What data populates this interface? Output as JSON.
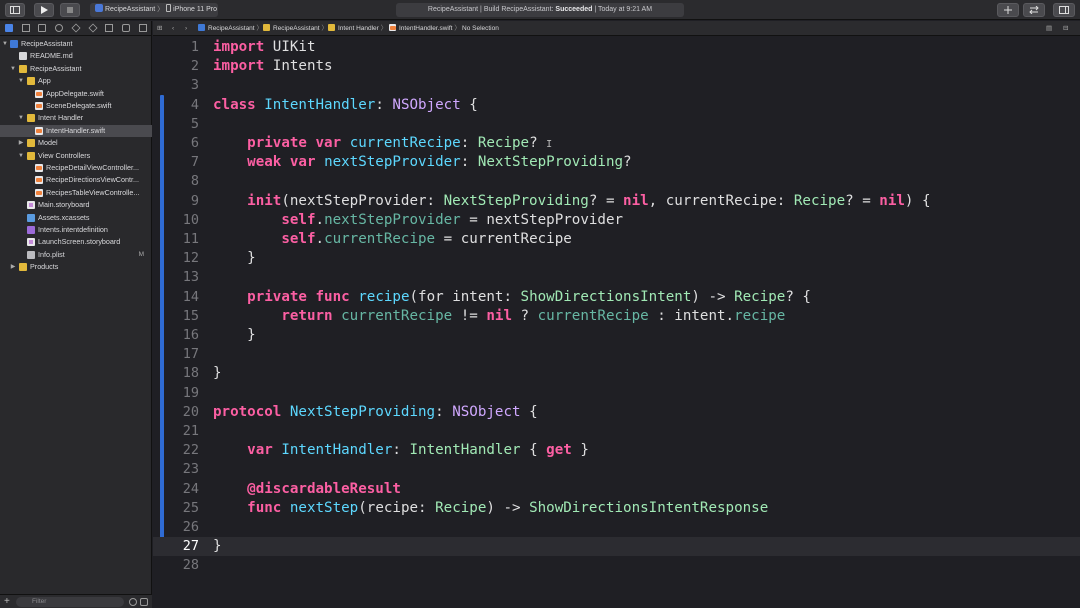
{
  "toolbar": {
    "scheme": "RecipeAssistant",
    "device": "iPhone 11 Pro",
    "activity_prefix": "RecipeAssistant | Build RecipeAssistant: ",
    "activity_status": "Succeeded",
    "activity_time": " | Today at 9:21 AM"
  },
  "navigator": {
    "items": [
      {
        "label": "RecipeAssistant",
        "icon": "project-icon"
      },
      {
        "label": "README.md",
        "icon": "document-icon"
      },
      {
        "label": "RecipeAssistant",
        "icon": "folder-icon"
      },
      {
        "label": "App",
        "icon": "folder-icon"
      },
      {
        "label": "AppDelegate.swift",
        "icon": "swift-file-icon"
      },
      {
        "label": "SceneDelegate.swift",
        "icon": "swift-file-icon"
      },
      {
        "label": "Intent Handler",
        "icon": "folder-icon"
      },
      {
        "label": "IntentHandler.swift",
        "icon": "swift-file-icon"
      },
      {
        "label": "Model",
        "icon": "folder-icon"
      },
      {
        "label": "View Controllers",
        "icon": "folder-icon"
      },
      {
        "label": "RecipeDetailViewController...",
        "icon": "swift-file-icon"
      },
      {
        "label": "RecipeDirectionsViewContr...",
        "icon": "swift-file-icon"
      },
      {
        "label": "RecipesTableViewControlle...",
        "icon": "swift-file-icon"
      },
      {
        "label": "Main.storyboard",
        "icon": "storyboard-icon"
      },
      {
        "label": "Assets.xcassets",
        "icon": "assets-icon"
      },
      {
        "label": "Intents.intentdefinition",
        "icon": "intent-definition-icon"
      },
      {
        "label": "LaunchScreen.storyboard",
        "icon": "storyboard-icon"
      },
      {
        "label": "Info.plist",
        "icon": "plist-icon",
        "badge": "M"
      },
      {
        "label": "Products",
        "icon": "folder-icon"
      }
    ],
    "filter_placeholder": "Filter"
  },
  "jumpbar": {
    "crumbs": [
      "RecipeAssistant",
      "RecipeAssistant",
      "Intent Handler",
      "IntentHandler.swift",
      "No Selection"
    ]
  },
  "editor": {
    "current_line": 27,
    "line_numbers": [
      "1",
      "2",
      "3",
      "4",
      "5",
      "6",
      "7",
      "8",
      "9",
      "10",
      "11",
      "12",
      "13",
      "14",
      "15",
      "16",
      "17",
      "18",
      "19",
      "20",
      "21",
      "22",
      "23",
      "24",
      "25",
      "26",
      "27",
      "28"
    ],
    "tokens": {
      "import": "import",
      "uikit": "UIKit",
      "intents": "Intents",
      "class": "class",
      "intent_handler": "IntentHandler",
      "colon": ": ",
      "nsobject": "NSObject",
      "open_brace": " {",
      "private": "private",
      "var": "var",
      "current_recipe": "currentRecipe",
      "recipe_type": "Recipe",
      "optional": "?",
      "weak": "weak",
      "next_step_provider": "nextStepProvider",
      "next_step_providing": "NextStepProviding",
      "init": "init",
      "nil": "nil",
      "self": "self",
      "assign": " = ",
      "func": "func",
      "recipe_fn": "recipe",
      "for_intent": "(for intent: ",
      "show_directions_intent": "ShowDirectionsIntent",
      "arrow": ") -> ",
      "return": "return",
      "neq": " != ",
      "ternary_q": " ? ",
      "ternary_c": " : ",
      "intent": "intent",
      "dot": ".",
      "recipe_prop": "recipe",
      "close_brace": "}",
      "protocol": "protocol",
      "get": "get",
      "discardable": "@discardableResult",
      "next_step": "nextStep",
      "recipe_param": "(recipe: ",
      "show_directions_response": "ShowDirectionsIntentResponse",
      "paren_close": ")",
      "comma_sp": ", ",
      "current_recipe_label": "currentRecipe: ",
      "next_step_provider_label": "(nextStepProvider: ",
      "brace_get_open": " { ",
      "brace_get_close": " }"
    }
  }
}
